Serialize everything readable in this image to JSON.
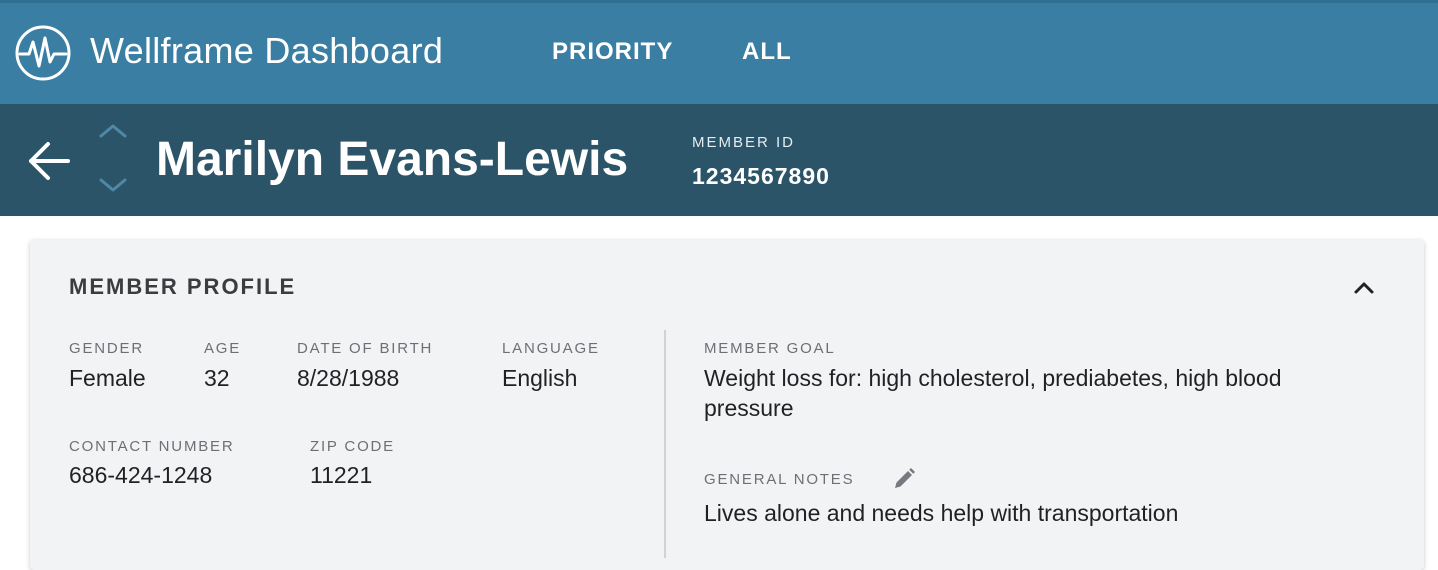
{
  "app": {
    "title": "Wellframe Dashboard",
    "logo_icon": "heartbeat-icon",
    "nav": [
      {
        "label": "PRIORITY"
      },
      {
        "label": "ALL"
      }
    ],
    "colors": {
      "topbar": "#3a7fa3",
      "member_bar": "#2b5468",
      "card": "#f2f3f5"
    }
  },
  "member": {
    "name": "Marilyn Evans-Lewis",
    "id_label": "MEMBER ID",
    "id_value": "1234567890"
  },
  "profile": {
    "title": "MEMBER PROFILE",
    "gender_label": "GENDER",
    "gender": "Female",
    "age_label": "AGE",
    "age": "32",
    "dob_label": "DATE OF BIRTH",
    "dob": "8/28/1988",
    "language_label": "LANGUAGE",
    "language": "English",
    "contact_label": "CONTACT NUMBER",
    "contact": "686-424-1248",
    "zip_label": "ZIP CODE",
    "zip": "11221",
    "goal_label": "MEMBER GOAL",
    "goal_line1": "Weight loss for: high cholesterol, prediabetes, high blood",
    "goal_line2": "pressure",
    "notes_label": "GENERAL NOTES",
    "notes": "Lives alone and needs help with transportation"
  }
}
